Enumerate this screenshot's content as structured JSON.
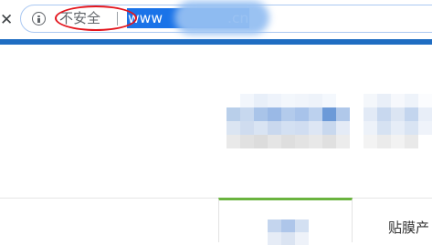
{
  "browser": {
    "close_glyph": "✕",
    "info_icon": "info-icon",
    "security_status": "不安全",
    "url_prefix": "www",
    "url_suffix": ".cn",
    "highlight_color": "#e3161e",
    "selection_color": "#1a73e8"
  },
  "page": {
    "accent_color": "#1f6dc2",
    "tab_accent_color": "#6ab33e",
    "tabs": [
      {
        "label": ""
      },
      {
        "label": "贴膜产"
      }
    ]
  }
}
